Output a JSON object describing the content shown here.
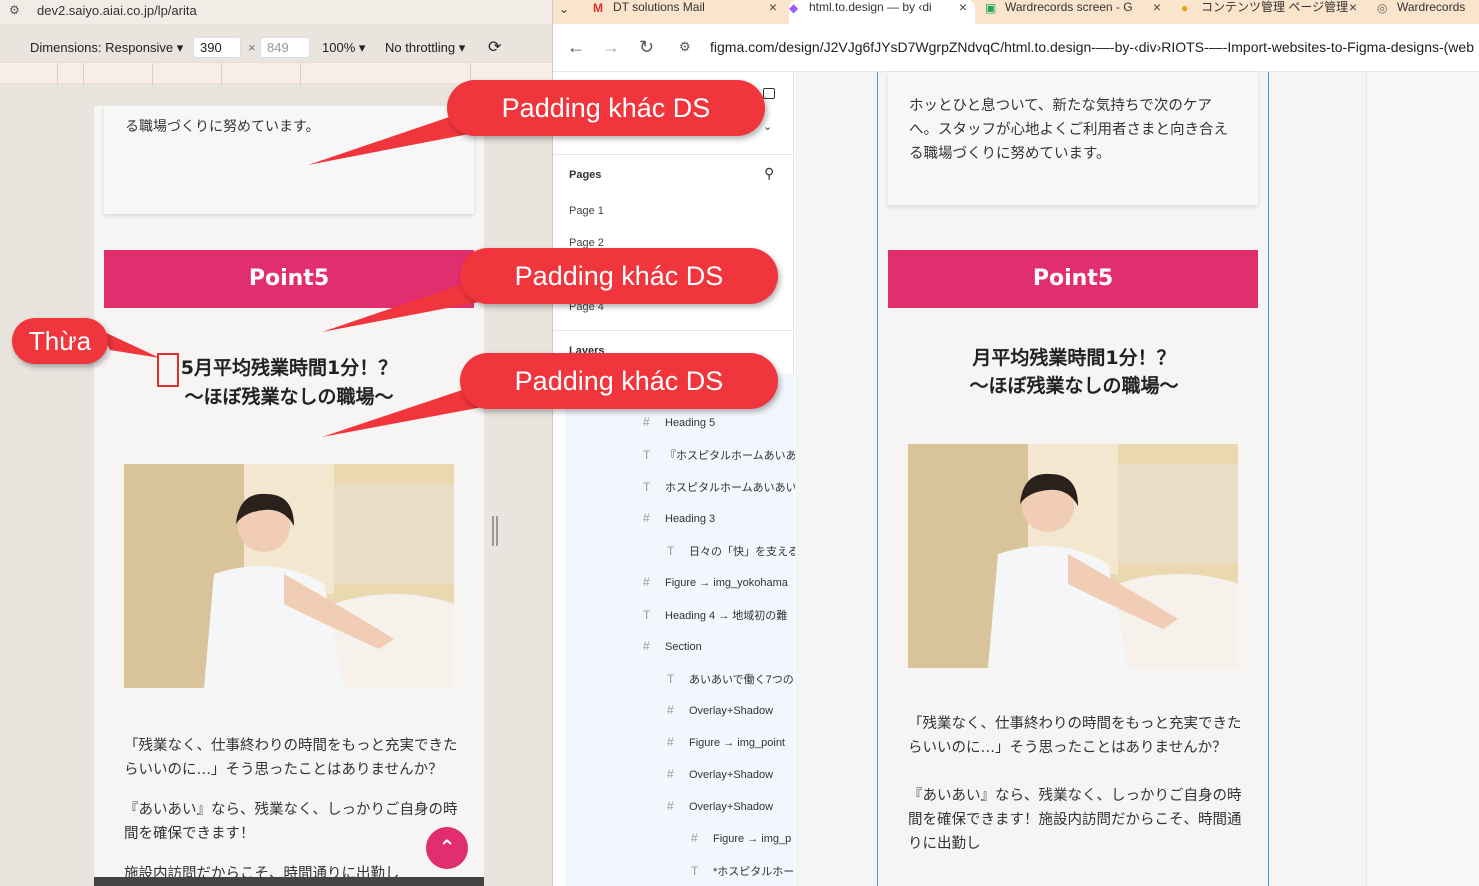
{
  "left_pane": {
    "url": "dev2.saiyo.aiai.co.jp/lp/arita",
    "device_toolbar": {
      "dimensions_label": "Dimensions: Responsive",
      "width": "390",
      "height": "849",
      "zoom": "100%",
      "throttling": "No throttling"
    },
    "mobile": {
      "card_text": "る職場づくりに努めています。",
      "point_label": "Point5",
      "heading_line1": "5月平均残業時間1分！？",
      "heading_line2": "〜ほぼ残業なしの職場〜",
      "body_p1": "「残業なく、仕事終わりの時間をもっと充実できたらいいのに…」そう思ったことはありませんか？",
      "body_p2": "『あいあい』なら、残業なく、しっかりご自身の時間を確保できます！",
      "body_p3": "施設内訪問だからこそ、時間通りに出勤し"
    }
  },
  "right_pane": {
    "tabs": [
      {
        "label": "DT solutions Mail"
      },
      {
        "label": "html.to.design — by ‹di"
      },
      {
        "label": "Wardrecords screen - G"
      },
      {
        "label": "コンテンツ管理 ページ管理"
      },
      {
        "label": "Wardrecords"
      }
    ],
    "url": "figma.com/design/J2VJg6fJYsD7WgrpZNdvqC/html.to.design-—-by-‹div›RIOTS-—-Import-websites-to-Figma-designs-(web",
    "figma": {
      "pages_title": "Pages",
      "pages": [
        "Page 1",
        "Page 2",
        "Page 4"
      ],
      "layers_title": "Layers",
      "layers": [
        {
          "label": "Heading 5"
        },
        {
          "label": "『ホスピタルホームあいあ"
        },
        {
          "label": "ホスピタルホームあいあい"
        },
        {
          "label": "Heading 3"
        },
        {
          "label": "日々の「快」を支える"
        },
        {
          "label": "Figure → img_yokohama"
        },
        {
          "label": "Heading 4 → 地域初の難"
        },
        {
          "label": "Section"
        },
        {
          "label": "あいあいで働く7つの"
        },
        {
          "label": "Overlay+Shadow"
        },
        {
          "label": "Figure → img_point"
        },
        {
          "label": "Overlay+Shadow"
        },
        {
          "label": "Overlay+Shadow"
        },
        {
          "label": "Figure → img_p"
        },
        {
          "label": "*ホスピタルホー"
        }
      ]
    },
    "frame": {
      "card_text": "ホッとひと息ついて、新たな気持ちで次のケアへ。スタッフが心地よくご利用者さまと向き合える職場づくりに努めています。",
      "point_label": "Point5",
      "heading_line1": "月平均残業時間1分！？",
      "heading_line2": "〜ほぼ残業なしの職場〜",
      "body_p1": "「残業なく、仕事終わりの時間をもっと充実できたらいいのに…」そう思ったことはありませんか？",
      "body_p2": "『あいあい』なら、残業なく、しっかりご自身の時間を確保できます！施設内訪問だからこそ、時間通りに出勤し"
    }
  },
  "annotations": {
    "callout_1": "Padding khác DS",
    "callout_2": "Padding khác DS",
    "callout_3": "Padding khác DS",
    "extra_label": "Thừa"
  },
  "colors": {
    "accent_pink": "#e12e6e",
    "callout_red": "#f0353d"
  }
}
